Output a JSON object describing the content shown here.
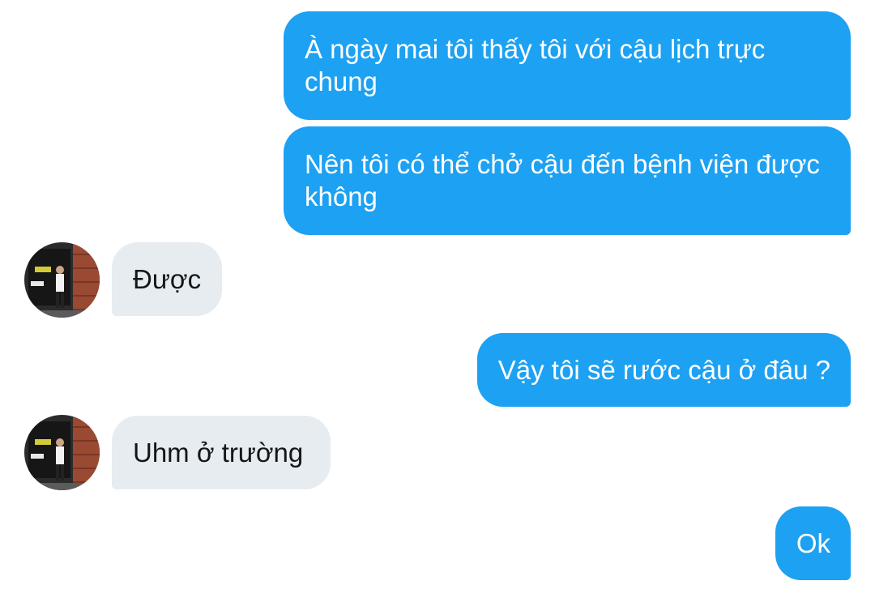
{
  "messages": [
    {
      "id": "m1",
      "direction": "outgoing",
      "text": "À ngày mai tôi thấy tôi với cậu lịch trực chung"
    },
    {
      "id": "m2",
      "direction": "outgoing",
      "text": "Nên tôi có thể chở cậu đến bệnh viện được không"
    },
    {
      "id": "m3",
      "direction": "incoming",
      "text": "Được"
    },
    {
      "id": "m4",
      "direction": "outgoing",
      "text": "Vậy tôi sẽ rước cậu ở đâu ?"
    },
    {
      "id": "m5",
      "direction": "incoming",
      "text": "Uhm ở trường"
    },
    {
      "id": "m6",
      "direction": "outgoing",
      "text": "Ok"
    }
  ],
  "avatar_icon": "contact-photo-avatar",
  "colors": {
    "outgoing_bubble": "#1da1f2",
    "incoming_bubble": "#e6ecf0",
    "outgoing_text": "#ffffff",
    "incoming_text": "#14171a"
  }
}
